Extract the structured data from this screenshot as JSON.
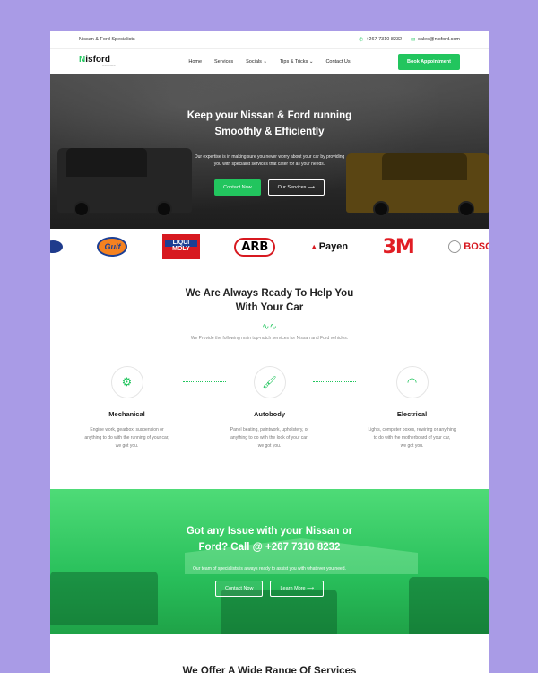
{
  "topbar": {
    "tagline": "Nissan & Ford Specialists",
    "phone": "+267 7310 8232",
    "email": "sales@nisford.com"
  },
  "nav": {
    "logo_first": "N",
    "logo_rest": "isford",
    "logo_sub": "Automotive",
    "items": [
      "Home",
      "Services",
      "Socials ⌄",
      "Tips & Tricks ⌄",
      "Contact Us"
    ],
    "cta": "Book Appointment"
  },
  "hero": {
    "title_line1": "Keep your Nissan & Ford running",
    "title_line2": "Smoothly & Efficiently",
    "text_line1": "Our expertise is in making sure you never worry about your car by providing",
    "text_line2": "you with specialist services that cater for all your needs.",
    "btn_primary": "Contact Now",
    "btn_secondary": "Our Services ⟶"
  },
  "brands": [
    "Ford",
    "Gulf",
    "LIQUI MOLY",
    "ARB",
    "Payen",
    "3M",
    "BOSCH"
  ],
  "services": {
    "title_line1": "We Are Always Ready To Help You",
    "title_line2": "With Your Car",
    "lead": "We Provide the following main top-notch services for Nissan and Ford vehicles.",
    "items": [
      {
        "icon": "gears-icon",
        "title": "Mechanical",
        "l1": "Engine work, gearbox, suspension or",
        "l2": "anything to do with the running of your car,",
        "l3": "we got you."
      },
      {
        "icon": "paint-brush-icon",
        "title": "Autobody",
        "l1": "Panel beating, paintwork, upholstery, or",
        "l2": "anything to do with the look of your car,",
        "l3": "we got you."
      },
      {
        "icon": "gauge-icon",
        "title": "Electrical",
        "l1": "Lights, computer boxes, rewiring or anything",
        "l2": "to do with the motherboard of your car,",
        "l3": "we got you."
      }
    ]
  },
  "issue": {
    "title_line1": "Got any Issue with your Nissan or",
    "title_line2": "Ford? Call @ +267 7310 8232",
    "text": "Our team of specialists is always ready to assist you with whatever you need.",
    "btn_primary": "Contact Now",
    "btn_secondary": "Learn More ⟶"
  },
  "next_section_title": "We Offer A Wide Range Of Services",
  "colors": {
    "accent": "#22c55e",
    "background": "#a99be6"
  }
}
